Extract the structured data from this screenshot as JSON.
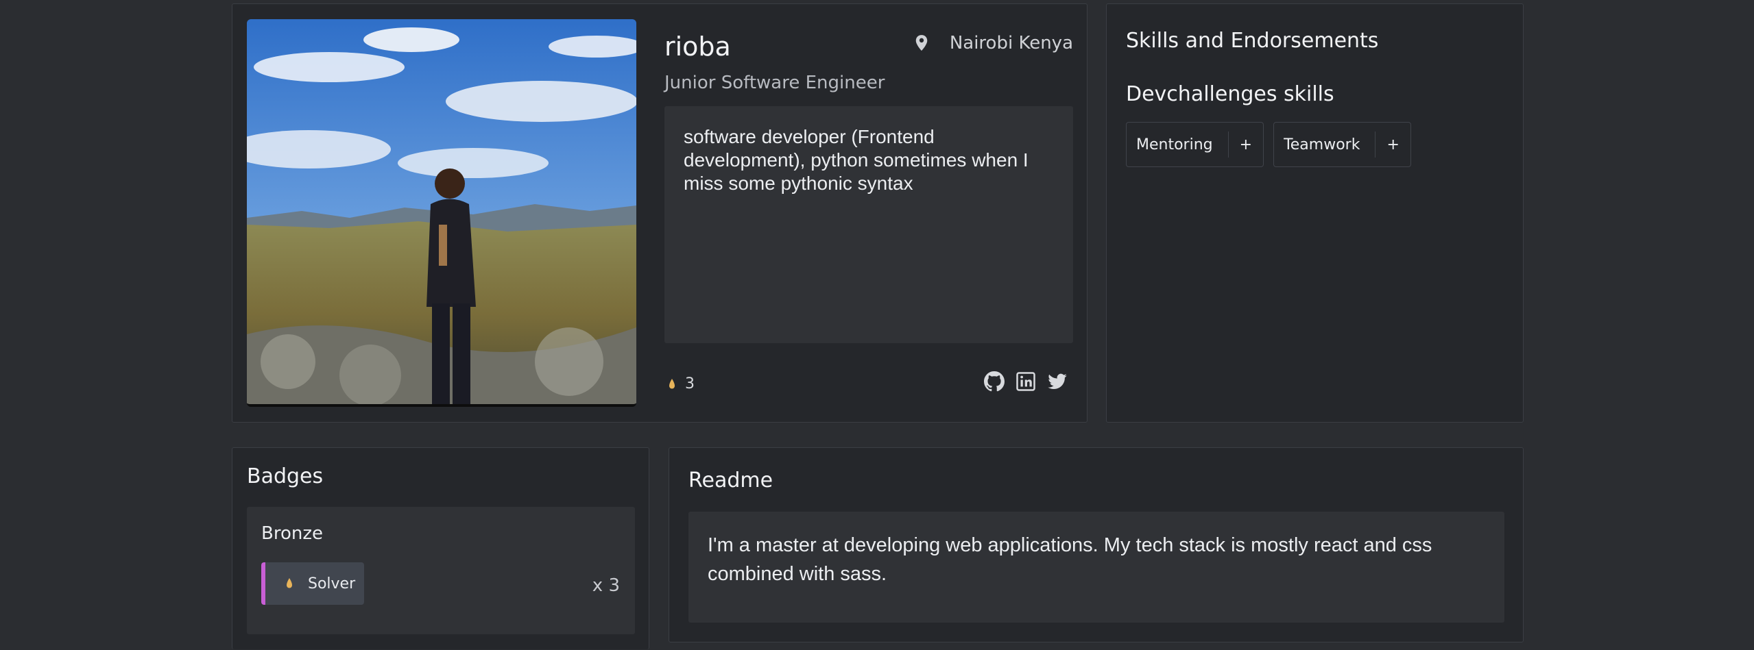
{
  "profile": {
    "name": "rioba",
    "title": "Junior Software Engineer",
    "location": "Nairobi Kenya",
    "bio": "software developer (Frontend development), python sometimes when I miss some pythonic syntax",
    "points": "3",
    "socials": [
      "github-icon",
      "linkedin-icon",
      "twitter-icon"
    ]
  },
  "skills": {
    "title": "Skills and Endorsements",
    "section_title": "Devchallenges skills",
    "items": [
      {
        "label": "Mentoring",
        "action": "+"
      },
      {
        "label": "Teamwork",
        "action": "+"
      }
    ]
  },
  "badges": {
    "title": "Badges",
    "groups": [
      {
        "title": "Bronze",
        "badge": "Solver",
        "count": "x 3",
        "accent": "#c85fd6"
      }
    ]
  },
  "readme": {
    "title": "Readme",
    "content": "I'm a master at developing web applications. My tech stack is mostly react and css combined with sass."
  },
  "colors": {
    "background": "#2b2d31",
    "card": "#25272b",
    "panel": "#303236",
    "badge_accent": "#c85fd6"
  }
}
